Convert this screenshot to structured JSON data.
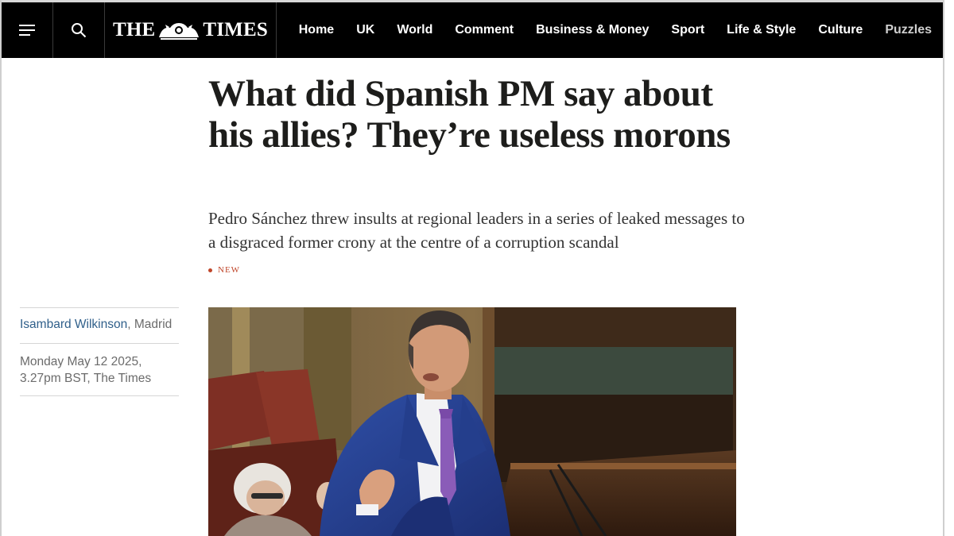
{
  "header": {
    "menu_icon": "menu-icon",
    "search_icon": "search-icon",
    "logo_left": "THE",
    "logo_right": "TIMES",
    "nav": [
      "Home",
      "UK",
      "World",
      "Comment",
      "Business & Money",
      "Sport",
      "Life & Style",
      "Culture",
      "Puzzles"
    ]
  },
  "article": {
    "headline": "What did Spanish PM say about his allies? They’re useless morons",
    "standfirst": "Pedro Sánchez threw insults at regional leaders in a series of leaked messages to a disgraced former crony at the centre of a corruption scandal",
    "badge": "NEW",
    "byline": {
      "author": "Isambard Wilkinson",
      "separator": ", ",
      "location": "Madrid"
    },
    "dateline": "Monday May 12 2025, 3.27pm BST, The Times"
  },
  "colors": {
    "nav_bg": "#000000",
    "accent_new": "#c0462a",
    "author_link": "#2f5f8a"
  }
}
